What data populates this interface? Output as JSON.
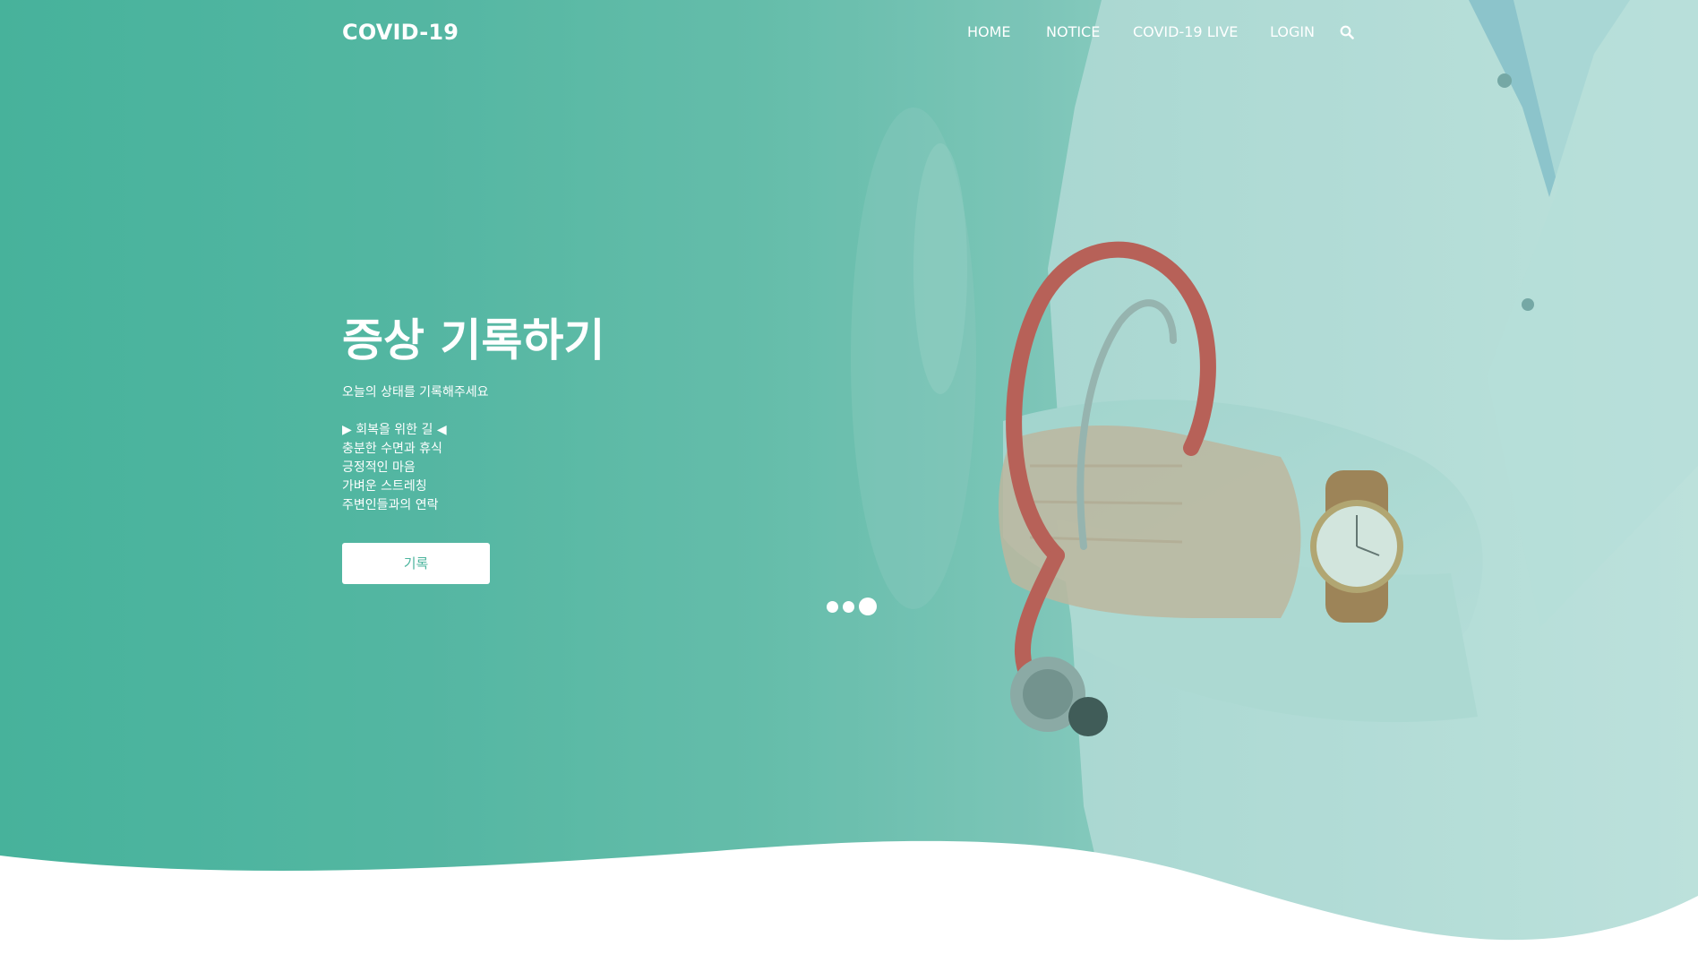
{
  "header": {
    "logo": "COVID-19",
    "nav": {
      "home": "HOME",
      "notice": "NOTICE",
      "covid_live": "COVID-19 LIVE",
      "login": "LOGIN"
    },
    "search_icon": "search-icon"
  },
  "hero": {
    "title": "증상 기록하기",
    "subtitle": "오늘의 상태를 기록해주세요",
    "tips": [
      "▶ 회복을 위한 길 ◀",
      "충분한 수면과 휴식",
      "긍정적인 마음",
      "가벼운 스트레칭",
      "주변인들과의 연락"
    ],
    "button_label": "기록",
    "slider_dots": 3,
    "active_dot": 3
  },
  "colors": {
    "teal": "#47b39c",
    "teal_light": "#c3e3e1",
    "white": "#ffffff",
    "button_text": "#4db59e"
  }
}
